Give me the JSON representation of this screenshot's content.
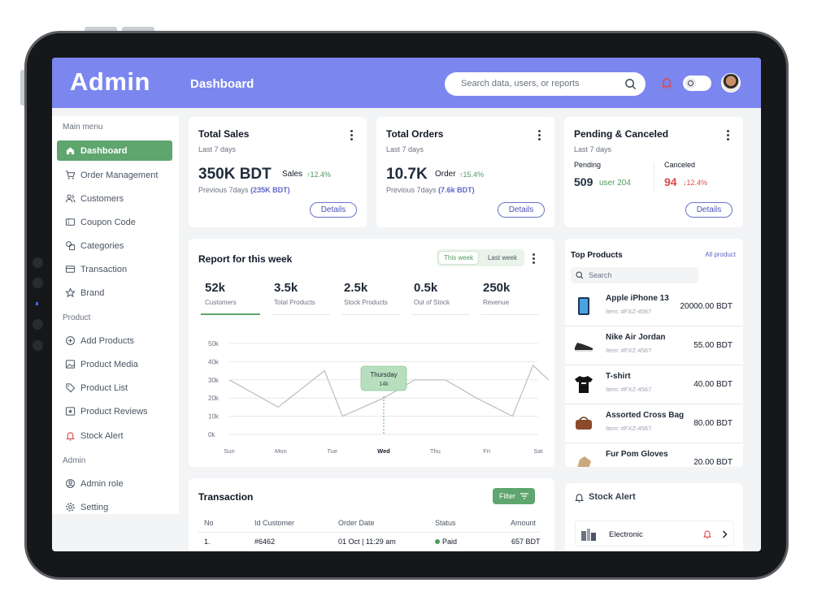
{
  "header": {
    "brand": "Admin",
    "title": "Dashboard",
    "search_placeholder": "Search data, users, or reports"
  },
  "sidebar": {
    "main_menu_label": "Main menu",
    "product_label": "Product",
    "admin_label": "Admin",
    "items": [
      {
        "label": "Dashboard",
        "icon": "home-icon"
      },
      {
        "label": "Order Management",
        "icon": "cart-icon"
      },
      {
        "label": "Customers",
        "icon": "users-icon"
      },
      {
        "label": "Coupon Code",
        "icon": "ticket-icon"
      },
      {
        "label": "Categories",
        "icon": "categories-icon"
      },
      {
        "label": "Transaction",
        "icon": "card-icon"
      },
      {
        "label": "Brand",
        "icon": "star-icon"
      },
      {
        "label": "Add Products",
        "icon": "plus-circle-icon"
      },
      {
        "label": "Product Media",
        "icon": "image-icon"
      },
      {
        "label": "Product List",
        "icon": "tag-icon"
      },
      {
        "label": "Product Reviews",
        "icon": "review-icon"
      },
      {
        "label": "Stock Alert",
        "icon": "bell-icon"
      },
      {
        "label": "Admin role",
        "icon": "user-circle-icon"
      },
      {
        "label": "Setting",
        "icon": "gear-icon"
      }
    ]
  },
  "total_sales": {
    "title": "Total Sales",
    "period": "Last 7 days",
    "value": "350K BDT",
    "label": "Sales",
    "change": "↑12.4%",
    "previous_text": "Previous 7days",
    "previous_value": "(235K BDT)",
    "details": "Details"
  },
  "total_orders": {
    "title": "Total Orders",
    "period": "Last 7 days",
    "value": "10.7K",
    "label": "Order",
    "change": "↑15.4%",
    "previous_text": "Previous 7days",
    "previous_value": "(7.6k BDT)",
    "details": "Details"
  },
  "pending": {
    "title": "Pending & Canceled",
    "period": "Last 7 days",
    "pending_label": "Pending",
    "pending_value": "509",
    "pending_user": "user 204",
    "canceled_label": "Canceled",
    "canceled_value": "94",
    "canceled_change": "↓12.4%",
    "details": "Details"
  },
  "report": {
    "title": "Report for this week",
    "this_week": "This week",
    "last_week": "Last week",
    "stats": [
      {
        "value": "52k",
        "label": "Customers"
      },
      {
        "value": "3.5k",
        "label": "Total Products"
      },
      {
        "value": "2.5k",
        "label": "Stock Products"
      },
      {
        "value": "0.5k",
        "label": "Out of Stock"
      },
      {
        "value": "250k",
        "label": "Revenue"
      }
    ],
    "tooltip_day": "Thursday",
    "tooltip_value": "14k"
  },
  "chart_data": {
    "type": "line",
    "x": [
      "Sun",
      "Mon",
      "Tue",
      "Wed",
      "Thu",
      "Fri",
      "Sat"
    ],
    "points_x": [
      0,
      0.95,
      1.85,
      2.2,
      3.0,
      3.6,
      4.2,
      4.8,
      5.5,
      5.9,
      6.2
    ],
    "series": [
      {
        "values": [
          30,
          15,
          35,
          10,
          20,
          30,
          30,
          20,
          10,
          38,
          30
        ]
      }
    ],
    "yticks": [
      "50k",
      "40k",
      "30k",
      "20k",
      "10k",
      "0k"
    ],
    "ylim": [
      0,
      50
    ],
    "highlight": "Wed",
    "grid": true,
    "colors": {
      "line": "#b9bdc4",
      "grid": "#e5e7eb",
      "tooltip": "#b7dfbd"
    }
  },
  "top_products": {
    "title": "Top Products",
    "all_link": "All product",
    "search_placeholder": "Search",
    "items": [
      {
        "name": "Apple iPhone 13",
        "id": "Item: #FXZ-4567",
        "price": "20000.00 BDT",
        "icon": "phone-icon"
      },
      {
        "name": "Nike Air Jordan",
        "id": "Item: #FXZ-4567",
        "price": "55.00 BDT",
        "icon": "shoe-icon"
      },
      {
        "name": "T-shirt",
        "id": "Item: #FXZ-4567",
        "price": "40.00 BDT",
        "icon": "tshirt-icon"
      },
      {
        "name": "Assorted Cross Bag",
        "id": "Item: #FXZ-4567",
        "price": "80.00 BDT",
        "icon": "bag-icon"
      },
      {
        "name": "Fur Pom Gloves",
        "id": "",
        "price": "20.00 BDT",
        "icon": "gloves-icon"
      }
    ]
  },
  "transaction": {
    "title": "Transaction",
    "filter": "Filter",
    "columns": [
      "No",
      "Id Customer",
      "Order Date",
      "Status",
      "Amount"
    ],
    "rows": [
      {
        "no": "1.",
        "id": "#6462",
        "date": "01 Oct | 11:29 am",
        "status": "Paid",
        "amount": "657 BDT"
      }
    ]
  },
  "stock_alert": {
    "title": "Stock Alert",
    "items": [
      {
        "label": "Electronic"
      }
    ]
  },
  "colors": {
    "header": "#7b86ef",
    "active": "#5fa56e",
    "up": "#4c9a5c",
    "down": "#e04848"
  }
}
